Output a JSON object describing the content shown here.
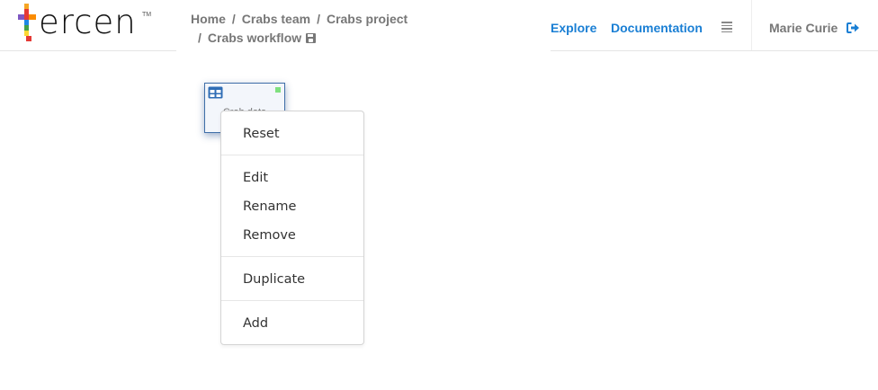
{
  "header": {
    "logo": {
      "text": "ercen",
      "tm": "TM"
    },
    "breadcrumb": [
      {
        "label": "Home"
      },
      {
        "label": "Crabs team"
      },
      {
        "label": "Crabs project"
      },
      {
        "label": "Crabs workflow"
      }
    ],
    "separator": "/",
    "nav": {
      "explore": "Explore",
      "documentation": "Documentation"
    },
    "user": {
      "name": "Marie Curie"
    },
    "colors": {
      "link": "#1a7fd4",
      "muted": "#777777"
    }
  },
  "workflow": {
    "steps": [
      {
        "label": "Crab data",
        "type": "table-step",
        "status_color": "#7fe07f"
      }
    ]
  },
  "context_menu": {
    "items": [
      {
        "label": "Reset"
      },
      {
        "label": "Edit"
      },
      {
        "label": "Rename"
      },
      {
        "label": "Remove"
      },
      {
        "label": "Duplicate"
      },
      {
        "label": "Add"
      }
    ]
  }
}
